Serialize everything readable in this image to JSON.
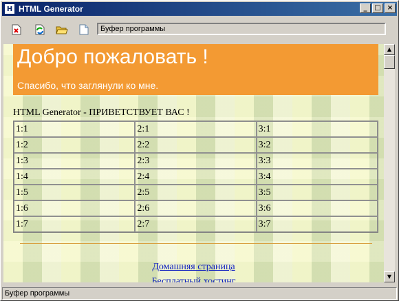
{
  "window": {
    "app_icon_letter": "H",
    "title": "HTML Generator",
    "minimize_glyph": "_",
    "maximize_glyph": "□",
    "close_glyph": "×"
  },
  "toolbar": {
    "buttons": [
      "new-red-icon",
      "refresh-icon",
      "open-folder-icon",
      "document-icon"
    ],
    "buffer_label": "Буфер программы"
  },
  "page": {
    "banner_title": "Добро пожаловать !",
    "banner_subtitle": "Спасибо, что заглянули ко мне.",
    "greeting": "HTML Generator - ПРИВЕТСТВУЕТ ВАС !",
    "table": [
      [
        "1:1",
        "2:1",
        "3:1"
      ],
      [
        "1:2",
        "2:2",
        "3:2"
      ],
      [
        "1:3",
        "2:3",
        "3:3"
      ],
      [
        "1:4",
        "2:4",
        "3:4"
      ],
      [
        "1:5",
        "2:5",
        "3:5"
      ],
      [
        "1:6",
        "2:6",
        "3:6"
      ],
      [
        "1:7",
        "2:7",
        "3:7"
      ]
    ],
    "links": [
      "Домашняя страница",
      "Бесплатный хостинг"
    ]
  },
  "scrollbar": {
    "up_glyph": "▲",
    "down_glyph": "▼"
  },
  "status": {
    "text": "Буфер программы"
  },
  "colors": {
    "banner": "#f39a33",
    "titlebar": "#0a246a",
    "link": "#1020c0"
  }
}
